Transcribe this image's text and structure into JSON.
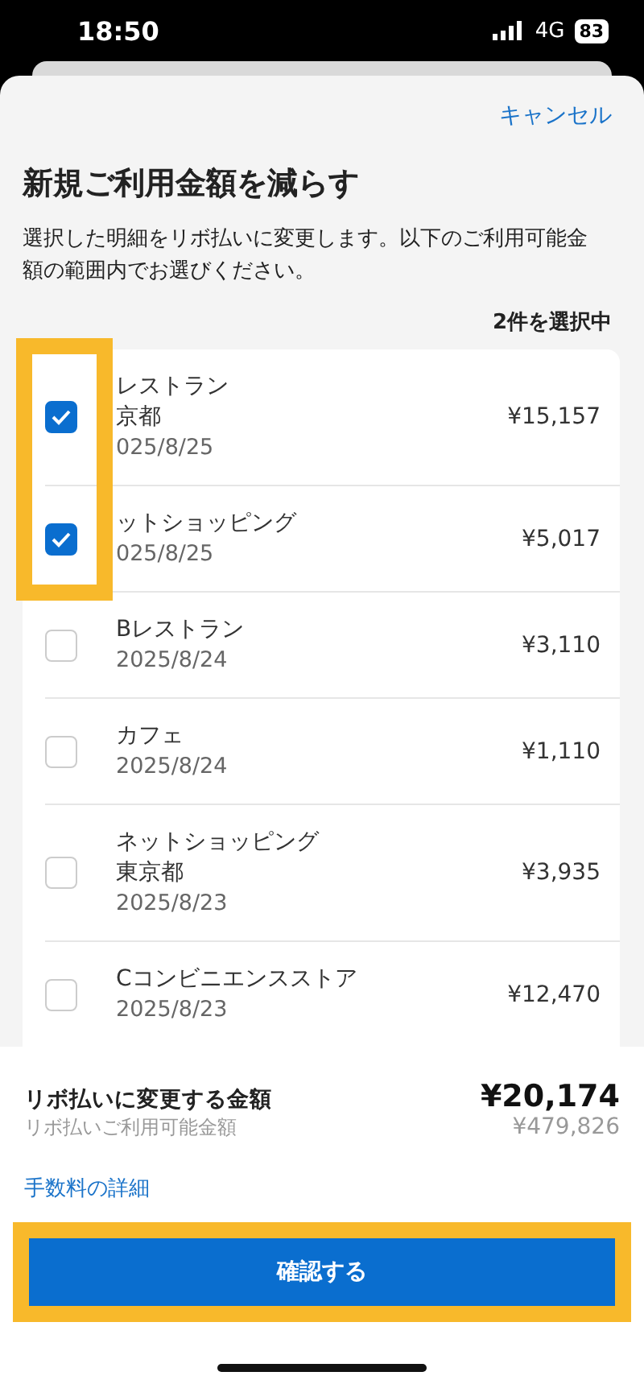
{
  "status_bar": {
    "time": "18:50",
    "network": "4G",
    "battery": "83"
  },
  "cancel": "キャンセル",
  "title": "新規ご利用金額を減らす",
  "description": "選択した明細をリボ払いに変更します。以下のご利用可能金額の範囲内でお選びください。",
  "selection_count": "2件を選択中",
  "transactions": [
    {
      "lines": [
        "レストラン",
        "京都"
      ],
      "date": "025/8/25",
      "amount": "¥15,157",
      "checked": true,
      "highlighted": true
    },
    {
      "lines": [
        "ットショッピング"
      ],
      "date": "025/8/25",
      "amount": "¥5,017",
      "checked": true,
      "highlighted": true
    },
    {
      "lines": [
        "Bレストラン"
      ],
      "date": "2025/8/24",
      "amount": "¥3,110",
      "checked": false,
      "highlighted": false
    },
    {
      "lines": [
        "カフェ"
      ],
      "date": "2025/8/24",
      "amount": "¥1,110",
      "checked": false,
      "highlighted": false
    },
    {
      "lines": [
        "ネットショッピング",
        "東京都"
      ],
      "date": "2025/8/23",
      "amount": "¥3,935",
      "checked": false,
      "highlighted": false
    },
    {
      "lines": [
        "Cコンビニエンスストア"
      ],
      "date": "2025/8/23",
      "amount": "¥12,470",
      "checked": false,
      "highlighted": false
    }
  ],
  "summary": {
    "change_label": "リボ払いに変更する金額",
    "change_amount": "¥20,174",
    "available_label": "リボ払いご利用可能金額",
    "available_amount": "¥479,826"
  },
  "fee_link": "手数料の詳細",
  "confirm_button": {
    "label": "確認する",
    "highlighted": true
  }
}
